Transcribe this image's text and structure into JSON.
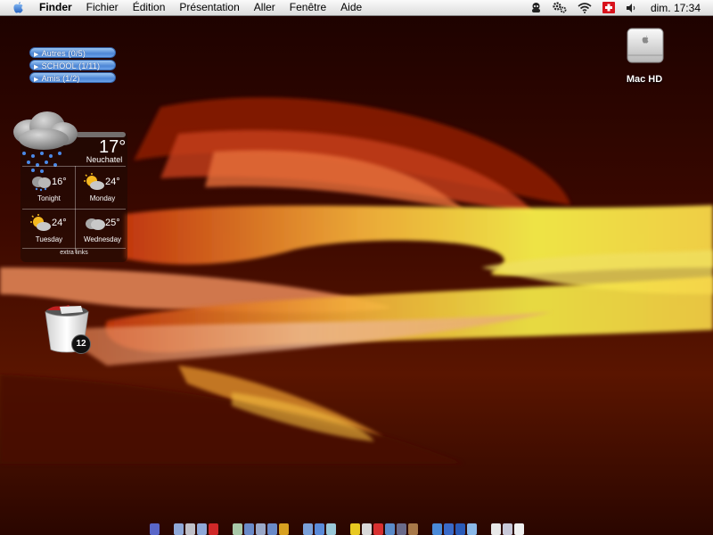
{
  "menubar": {
    "apple_icon": "apple-icon",
    "app_name": "Finder",
    "menus": [
      "Fichier",
      "Édition",
      "Présentation",
      "Aller",
      "Fenêtre",
      "Aide"
    ],
    "extras": {
      "icons": [
        "user-agent-icon",
        "gear-icon",
        "wifi-icon",
        "swiss-flag-icon",
        "speaker-icon"
      ],
      "clock": "dim. 17:34"
    }
  },
  "drawers": [
    {
      "label": "Autres (0/5)"
    },
    {
      "label": "SCHOOL (1/11)"
    },
    {
      "label": "Amis (1/2)"
    }
  ],
  "weather": {
    "current_temp": "17°",
    "city": "Neuchatel",
    "forecast": [
      {
        "temp": "16°",
        "day": "Tonight",
        "icon": "night-cloud-icon"
      },
      {
        "temp": "24°",
        "day": "Monday",
        "icon": "sun-cloud-icon"
      },
      {
        "temp": "24°",
        "day": "Tuesday",
        "icon": "sun-cloud-icon"
      },
      {
        "temp": "25°",
        "day": "Wednesday",
        "icon": "cloud-icon"
      }
    ],
    "extra_links": "extra links"
  },
  "desktop": {
    "hd_label": "Mac HD",
    "trash_count": "12"
  },
  "dock": {
    "icons": [
      "app-icon",
      "app-icon",
      "app-icon",
      "app-icon",
      "app-icon",
      "app-icon",
      "app-icon",
      "app-icon",
      "app-icon",
      "app-icon",
      "app-icon",
      "app-icon",
      "app-icon",
      "app-icon",
      "app-icon",
      "app-icon",
      "app-icon",
      "app-icon",
      "app-icon",
      "app-icon",
      "app-icon",
      "app-icon",
      "app-icon",
      "app-icon",
      "trash-icon"
    ]
  },
  "colors": {
    "wallpaper_dark": "#2a0500",
    "wallpaper_orange": "#e8541a",
    "wallpaper_yellow": "#f7f34a",
    "drawer_blue": "#4d86d6"
  }
}
